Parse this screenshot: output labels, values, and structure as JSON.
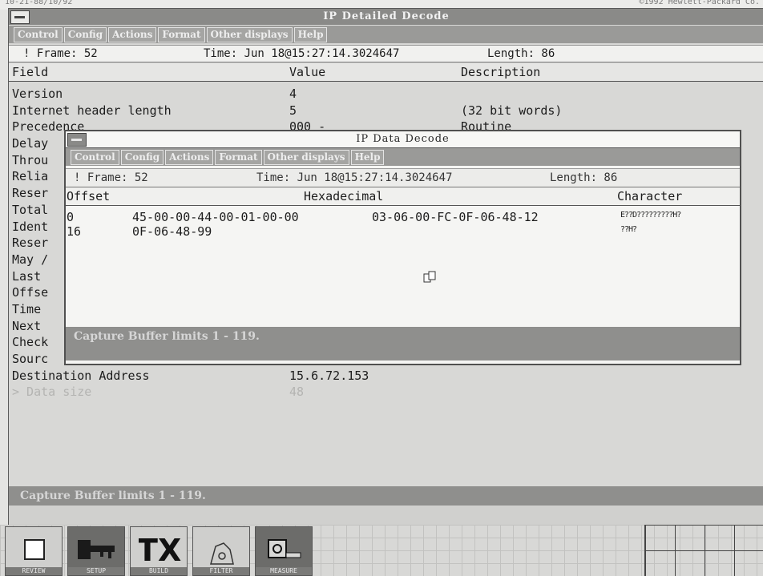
{
  "top_strip": {
    "left": "10-21-88/10/92",
    "right": "©1992 Hewlett-Packard Co."
  },
  "main_window": {
    "title": "IP Detailed Decode",
    "menu": [
      "Control",
      "Config",
      "Actions",
      "Format",
      "Other displays",
      "Help"
    ],
    "info": {
      "frame": "! Frame: 52",
      "time": "Time: Jun 18@15:27:14.3024647",
      "length": "Length: 86"
    },
    "columns": {
      "field": "Field",
      "value": "Value",
      "description": "Description"
    },
    "rows": [
      {
        "field": "Version",
        "value": "4",
        "description": ""
      },
      {
        "field": "Internet header length",
        "value": "5",
        "description": "(32 bit words)"
      },
      {
        "field": "Precedence",
        "value": "000 -",
        "description": "Routine"
      },
      {
        "field": "Delay",
        "value": "",
        "description": ""
      },
      {
        "field": "Throu",
        "value": "",
        "description": ""
      },
      {
        "field": "Relia",
        "value": "",
        "description": ""
      },
      {
        "field": "Reser",
        "value": "",
        "description": ""
      },
      {
        "field": "Total",
        "value": "",
        "description": ""
      },
      {
        "field": "Ident",
        "value": "",
        "description": ""
      },
      {
        "field": "Reser",
        "value": "",
        "description": ""
      },
      {
        "field": "May /",
        "value": "",
        "description": ""
      },
      {
        "field": "Last",
        "value": "",
        "description": ""
      },
      {
        "field": "Offse",
        "value": "",
        "description": ""
      },
      {
        "field": "Time",
        "value": "",
        "description": ""
      },
      {
        "field": "Next",
        "value": "",
        "description": ""
      },
      {
        "field": "Check",
        "value": "",
        "description": ""
      },
      {
        "field": "Sourc",
        "value": "",
        "description": ""
      },
      {
        "field": "Destination Address",
        "value": "15.6.72.153",
        "description": ""
      },
      {
        "field": "> Data size",
        "value": "48",
        "description": ""
      }
    ],
    "status": "Capture Buffer limits 1 - 119."
  },
  "data_window": {
    "title": "IP Data Decode",
    "menu": [
      "Control",
      "Config",
      "Actions",
      "Format",
      "Other displays",
      "Help"
    ],
    "info": {
      "frame": "! Frame: 52",
      "time": "Time: Jun 18@15:27:14.3024647",
      "length": "Length: 86"
    },
    "columns": {
      "offset": "Offset",
      "hex": "Hexadecimal",
      "character": "Character"
    },
    "rows": [
      {
        "offset": "0",
        "hex_a": "45-00-00-44-00-01-00-00",
        "hex_b": "03-06-00-FC-0F-06-48-12",
        "chars": "E??D?????????H?"
      },
      {
        "offset": "16",
        "hex_a": "0F-06-48-99",
        "hex_b": "",
        "chars": "??H?"
      }
    ],
    "status": "Capture Buffer limits 1 - 119."
  },
  "taskbar": {
    "buttons": [
      {
        "label": "REVIEW",
        "icon": "blank-square-icon"
      },
      {
        "label": "SETUP",
        "icon": "key-icon"
      },
      {
        "label": "BUILD",
        "icon": "tx-tools-icon"
      },
      {
        "label": "FILTER",
        "icon": "filter-icon"
      },
      {
        "label": "MEASURE",
        "icon": "tape-measure-icon"
      }
    ]
  }
}
